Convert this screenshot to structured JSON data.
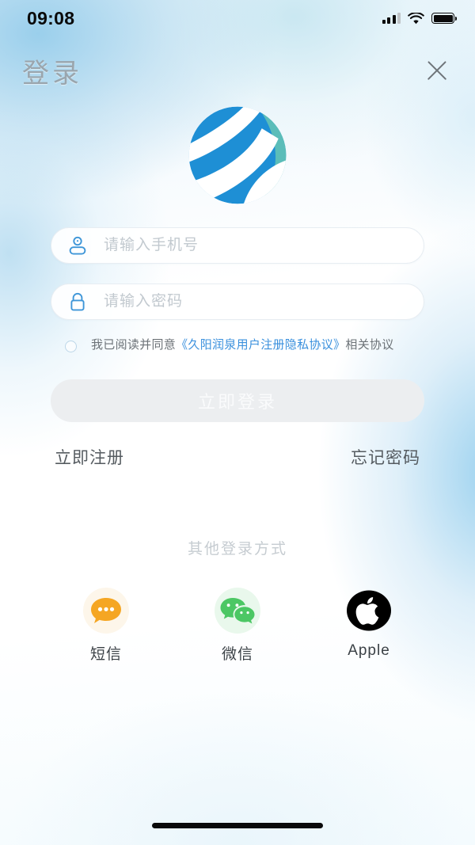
{
  "statusbar": {
    "time": "09:08",
    "signal_icon": "signal-bars-icon",
    "wifi_icon": "wifi-icon",
    "battery_icon": "battery-full-icon"
  },
  "header": {
    "title": "登录",
    "close_icon": "close-icon"
  },
  "brand": {
    "logo_icon": "globe-logo-icon",
    "logo_blue": "#1E8FD5",
    "logo_teal": "#5BBDB9"
  },
  "form": {
    "phone": {
      "icon": "user-icon",
      "placeholder": "请输入手机号",
      "value": ""
    },
    "password": {
      "icon": "lock-icon",
      "placeholder": "请输入密码",
      "value": ""
    },
    "agreement": {
      "checkbox_icon": "radio-unchecked-icon",
      "checked": false,
      "prefix": "我已阅读并同意",
      "link": "《久阳润泉用户注册隐私协议》",
      "suffix": "相关协议",
      "link_color": "#3A90DD"
    },
    "login_button": {
      "label": "立即登录",
      "disabled": true,
      "bg_color": "#ECEEF0",
      "text_color": "#FAFBFC"
    },
    "register_link": "立即注册",
    "forgot_link": "忘记密码"
  },
  "other_login": {
    "title": "其他登录方式",
    "methods": [
      {
        "label": "短信",
        "icon": "sms-bubble-icon",
        "color": "#F5A623",
        "bg": "#FDF6EA"
      },
      {
        "label": "微信",
        "icon": "wechat-icon",
        "color": "#4CC764",
        "bg": "#E9F8EC"
      },
      {
        "label": "Apple",
        "icon": "apple-logo-icon",
        "color": "#000000",
        "bg": "transparent"
      }
    ]
  },
  "system": {
    "home_indicator": "home-indicator-bar"
  }
}
